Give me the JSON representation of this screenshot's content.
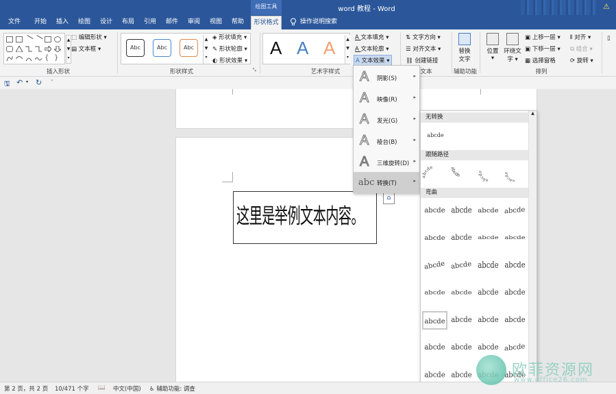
{
  "window": {
    "drawing_tools": "绘图工具",
    "title": "word 教程 - Word",
    "warning": "⚠"
  },
  "menu": {
    "file": "文件",
    "items": [
      "开始",
      "插入",
      "绘图",
      "设计",
      "布局",
      "引用",
      "邮件",
      "审阅",
      "视图",
      "帮助"
    ],
    "active_tab": "形状格式",
    "tell_me": "操作说明搜索"
  },
  "ribbon": {
    "insert_shapes": {
      "edit_shape": "编辑形状",
      "text_box": "文本框",
      "label": "插入形状"
    },
    "shape_styles": {
      "presets": [
        "Abc",
        "Abc",
        "Abc"
      ],
      "preset_colors": [
        "#333333",
        "#4a86c8",
        "#e08a4a"
      ],
      "fill": "形状填充",
      "outline": "形状轮廓",
      "effects": "形状效果",
      "label": "形状样式"
    },
    "wordart": {
      "letters": [
        "A",
        "A",
        "A"
      ],
      "letter_colors": [
        "#111111",
        "#4a7ec0",
        "#f0a070"
      ],
      "text_fill": "文本填充",
      "text_outline": "文本轮廓",
      "text_effects": "文本效果",
      "label": "艺术字样式"
    },
    "text": {
      "direction": "文字方向",
      "align": "对齐文本",
      "link": "创建链接",
      "label": "文本"
    },
    "accessibility": {
      "alt_text_1": "替换",
      "alt_text_2": "文字",
      "label": "辅助功能"
    },
    "arrange": {
      "position": "位置",
      "wrap_1": "环绕文",
      "wrap_2": "字",
      "forward": "上移一层",
      "backward": "下移一层",
      "pane": "选择窗格",
      "align": "对齐",
      "group": "组合",
      "rotate": "旋转",
      "label": "排列"
    }
  },
  "document": {
    "textbox_text": "这里是举例文本内容。"
  },
  "text_effects_menu": {
    "items": [
      {
        "label": "阴影(S)"
      },
      {
        "label": "映像(R)"
      },
      {
        "label": "发光(G)"
      },
      {
        "label": "棱台(B)"
      },
      {
        "label": "三维旋转(D)"
      },
      {
        "label": "转换(T)"
      }
    ],
    "selected": "转换(T)"
  },
  "transform_submenu": {
    "sections": [
      "无转换",
      "跟随路径",
      "弯曲"
    ],
    "no_transform_sample": "abcde",
    "follow_path_samples": [
      "abcde",
      "abcde",
      "abcde",
      "abcde"
    ],
    "warp_sample": "abcde"
  },
  "status": {
    "page": "第 2 页，共 2 页",
    "words": "10/471 个字",
    "language": "中文(中国)",
    "accessibility": "辅助功能: 调查"
  },
  "watermark": {
    "text": "欧菲资源网",
    "url": "www.office26.com"
  }
}
